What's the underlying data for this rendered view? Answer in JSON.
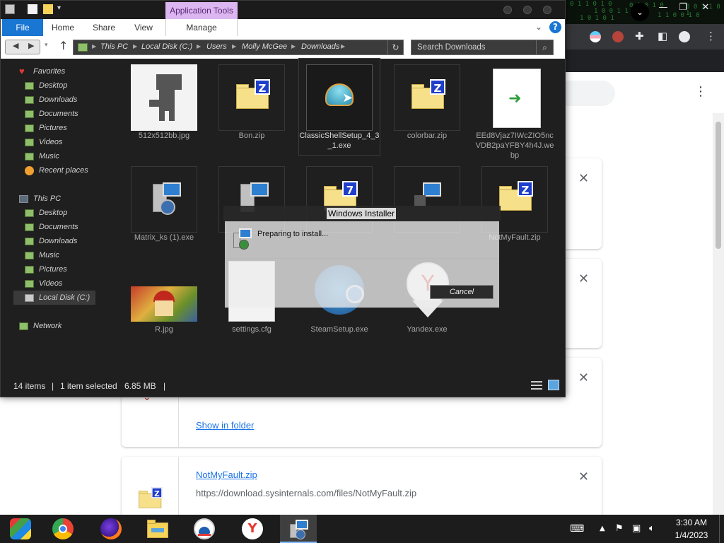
{
  "explorer": {
    "context_tab": "Application Tools",
    "ribbon_tabs": [
      "File",
      "Home",
      "Share",
      "View",
      "Manage"
    ],
    "breadcrumb": [
      "This PC",
      "Local Disk (C:)",
      "Users",
      "Molly McGee",
      "Downloads"
    ],
    "search_placeholder": "Search Downloads",
    "nav_pane": {
      "favorites": {
        "label": "Favorites",
        "items": [
          "Desktop",
          "Downloads",
          "Documents",
          "Pictures",
          "Videos",
          "Music",
          "Recent places"
        ]
      },
      "this_pc": {
        "label": "This PC",
        "items": [
          "Desktop",
          "Documents",
          "Downloads",
          "Music",
          "Pictures",
          "Videos",
          "Local Disk (C:)"
        ]
      },
      "network": "Network"
    },
    "files": [
      {
        "name": "512x512bb.jpg",
        "kind": "dino-image"
      },
      {
        "name": "Bon.zip",
        "kind": "zip"
      },
      {
        "name": "ClassicShellSetup_4_3_1.exe",
        "kind": "shell",
        "selected": true
      },
      {
        "name": "colorbar.zip",
        "kind": "zip"
      },
      {
        "name": "EEd8Vjaz7IWcZIO5ncVDB2paYFBY4h4J.webp",
        "kind": "webp"
      },
      {
        "name": "Matrix_ks (1).exe",
        "kind": "installer"
      },
      {
        "name": "",
        "kind": "installer"
      },
      {
        "name": "",
        "kind": "zip7"
      },
      {
        "name": "",
        "kind": "network-setup"
      },
      {
        "name": "NotMyFault.zip",
        "kind": "zip"
      },
      {
        "name": "R.jpg",
        "kind": "parappa-image"
      },
      {
        "name": "settings.cfg",
        "kind": "document"
      },
      {
        "name": "SteamSetup.exe",
        "kind": "steam"
      },
      {
        "name": "Yandex.exe",
        "kind": "yandex"
      }
    ],
    "status": {
      "count": "14 items",
      "selected": "1 item selected",
      "size": "6.85 MB"
    }
  },
  "installer": {
    "title": "Windows Installer",
    "message": "Preparing to install...",
    "cancel_label": "Cancel"
  },
  "downloads": {
    "card_link_show": "Show in folder",
    "card_name": "NotMyFault.zip",
    "card_url": "https://download.sysinternals.com/files/NotMyFault.zip"
  },
  "taskbar": {
    "apps": [
      "file-explorer-classic",
      "chrome",
      "firefox",
      "file-explorer",
      "classicshell-start",
      "yandex",
      "windows-installer"
    ],
    "clock_time": "3:30 AM",
    "clock_date": "1/4/2023"
  },
  "colors": {
    "explorer_bg": "#1f1f1f",
    "accent_blue": "#1976d2",
    "context_tab": "#dcb6f0",
    "link_blue": "#1a73e8"
  }
}
